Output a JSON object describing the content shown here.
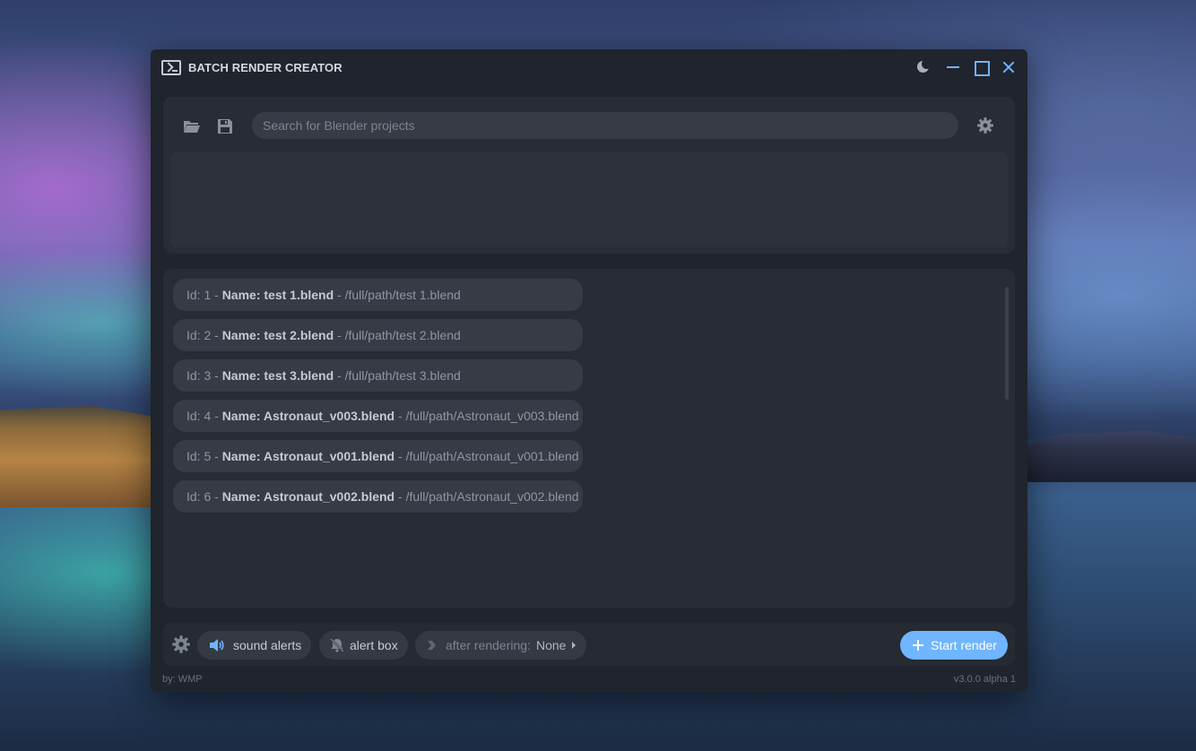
{
  "window": {
    "title": "BATCH RENDER CREATOR"
  },
  "toolbar": {
    "search_placeholder": "Search for Blender projects"
  },
  "projects": [
    {
      "id_label": "Id: 1 - ",
      "name": "Name: test 1.blend",
      "path": " - /full/path/test 1.blend"
    },
    {
      "id_label": "Id: 2 - ",
      "name": "Name: test 2.blend",
      "path": " - /full/path/test 2.blend"
    },
    {
      "id_label": "Id: 3 - ",
      "name": "Name: test 3.blend",
      "path": " - /full/path/test 3.blend"
    },
    {
      "id_label": "Id: 4 - ",
      "name": "Name: Astronaut_v003.blend",
      "path": " - /full/path/Astronaut_v003.blend"
    },
    {
      "id_label": "Id: 5 - ",
      "name": "Name: Astronaut_v001.blend",
      "path": " - /full/path/Astronaut_v001.blend"
    },
    {
      "id_label": "Id: 6 - ",
      "name": "Name: Astronaut_v002.blend",
      "path": " - /full/path/Astronaut_v002.blend"
    }
  ],
  "bottom": {
    "sound_alerts": "sound alerts",
    "alert_box": "alert box",
    "after_rendering_label": "after rendering:",
    "after_rendering_value": "None",
    "start_render": "Start render"
  },
  "footer": {
    "author": "by: WMP",
    "version": "v3.0.0 alpha 1"
  },
  "colors": {
    "accent": "#6fb5ff",
    "window_bg": "#20242c",
    "panel_bg": "#282c35",
    "item_bg": "#363b46"
  },
  "icons": [
    "terminal-icon",
    "moon-icon",
    "minimize-icon",
    "maximize-icon",
    "close-icon",
    "folder-icon",
    "save-icon",
    "gear-icon",
    "speaker-icon",
    "bell-off-icon",
    "next-icon",
    "caret-right-icon",
    "plus-icon"
  ]
}
